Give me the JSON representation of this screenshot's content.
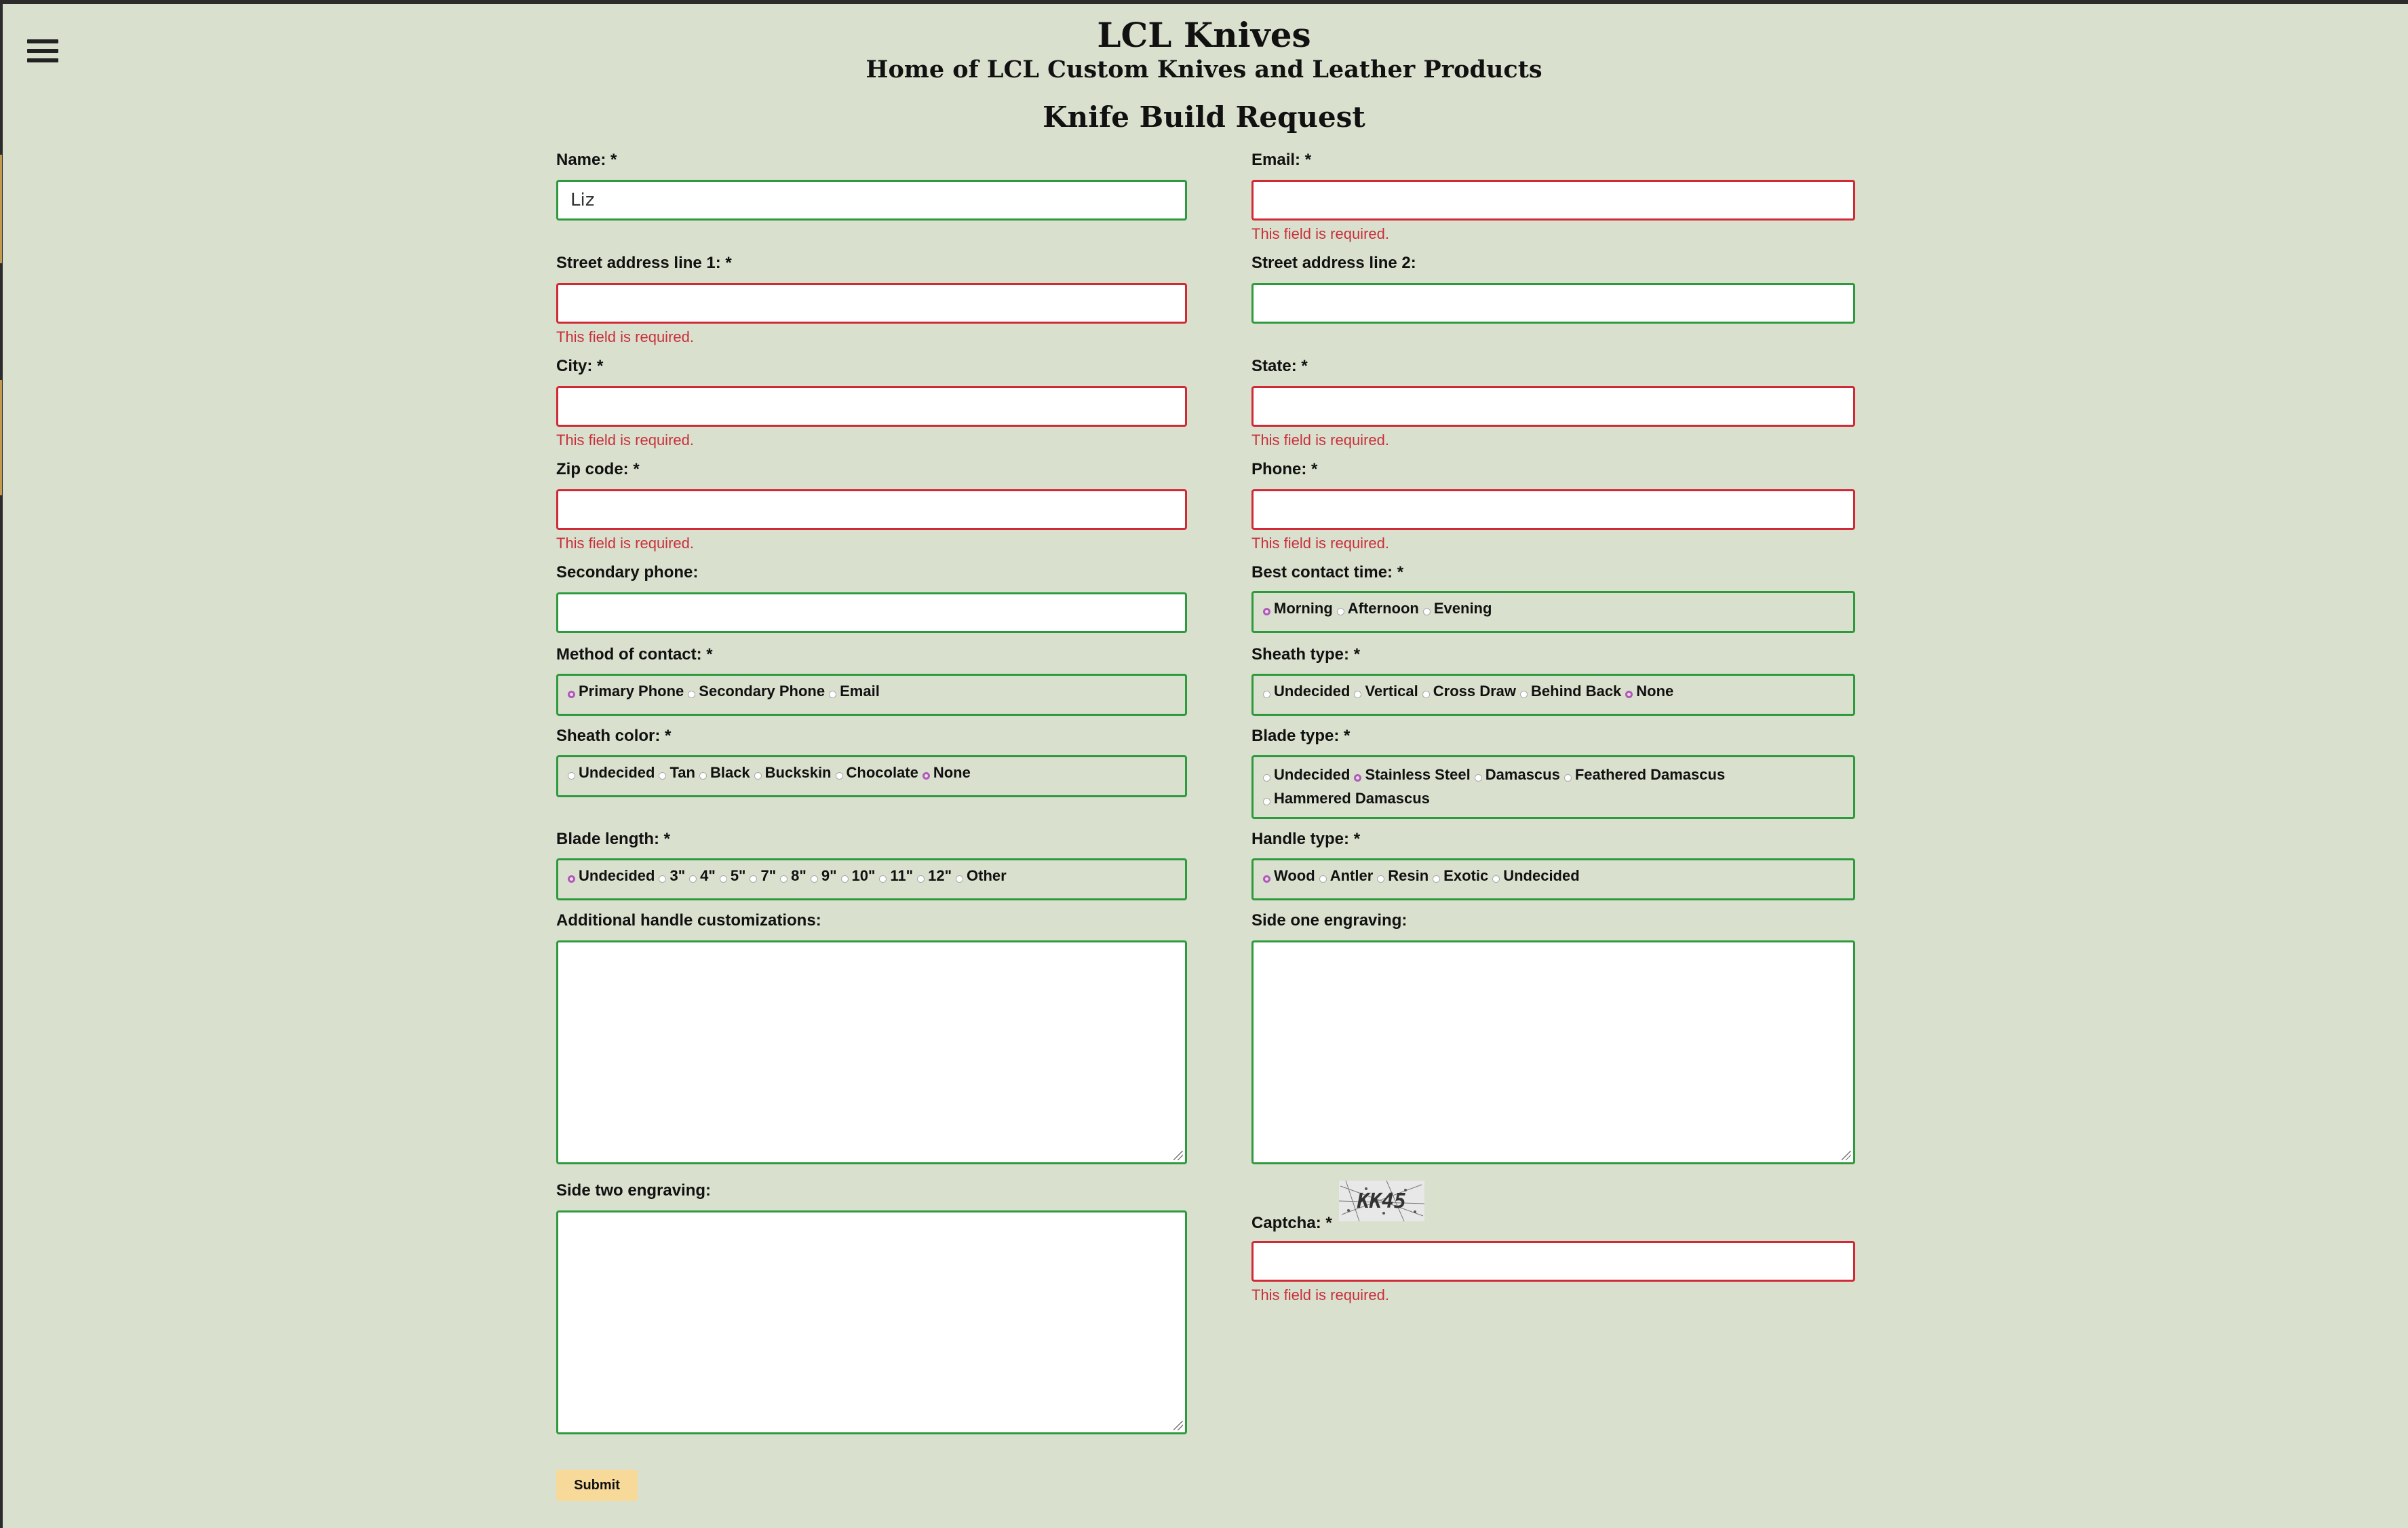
{
  "header": {
    "site_title": "LCL Knives",
    "tagline": "Home of LCL Custom Knives and Leather Products",
    "form_title": "Knife Build Request"
  },
  "nav": {
    "menu_icon": "hamburger-menu-icon"
  },
  "validation": {
    "required_message": "This field is required."
  },
  "fields": {
    "name": {
      "label": "Name: *",
      "value": "Liz"
    },
    "email": {
      "label": "Email: *",
      "value": ""
    },
    "street1": {
      "label": "Street address line 1: *",
      "value": ""
    },
    "street2": {
      "label": "Street address line 2:",
      "value": ""
    },
    "city": {
      "label": "City: *",
      "value": ""
    },
    "state": {
      "label": "State: *",
      "value": ""
    },
    "zip": {
      "label": "Zip code: *",
      "value": ""
    },
    "phone": {
      "label": "Phone: *",
      "value": ""
    },
    "secondary_phone": {
      "label": "Secondary phone:",
      "value": ""
    },
    "captcha": {
      "label": "Captcha: *",
      "value": "",
      "image_text": "KK45"
    }
  },
  "radios": {
    "best_contact_time": {
      "label": "Best contact time: *",
      "options": [
        "Morning",
        "Afternoon",
        "Evening"
      ],
      "selected": "Morning"
    },
    "method_of_contact": {
      "label": "Method of contact: *",
      "options": [
        "Primary Phone",
        "Secondary Phone",
        "Email"
      ],
      "selected": "Primary Phone"
    },
    "sheath_type": {
      "label": "Sheath type: *",
      "options": [
        "Undecided",
        "Vertical",
        "Cross Draw",
        "Behind Back",
        "None"
      ],
      "selected": "None"
    },
    "sheath_color": {
      "label": "Sheath color: *",
      "options": [
        "Undecided",
        "Tan",
        "Black",
        "Buckskin",
        "Chocolate",
        "None"
      ],
      "selected": "None"
    },
    "blade_type": {
      "label": "Blade type: *",
      "options": [
        "Undecided",
        "Stainless Steel",
        "Damascus",
        "Feathered Damascus",
        "Hammered Damascus"
      ],
      "selected": "Stainless Steel"
    },
    "blade_length": {
      "label": "Blade length: *",
      "options": [
        "Undecided",
        "3\"",
        "4\"",
        "5\"",
        "7\"",
        "8\"",
        "9\"",
        "10\"",
        "11\"",
        "12\"",
        "Other"
      ],
      "selected": "Undecided"
    },
    "handle_type": {
      "label": "Handle type: *",
      "options": [
        "Wood",
        "Antler",
        "Resin",
        "Exotic",
        "Undecided"
      ],
      "selected": "Wood"
    }
  },
  "textareas": {
    "handle_customizations": {
      "label": "Additional handle customizations:",
      "value": ""
    },
    "side_one_engraving": {
      "label": "Side one engraving:",
      "value": ""
    },
    "side_two_engraving": {
      "label": "Side two engraving:",
      "value": ""
    }
  },
  "submit_label": "Submit",
  "colors": {
    "background": "#dae0ce",
    "valid_border": "#2e9a3e",
    "error_border": "#d02a37",
    "error_text": "#c8303b",
    "submit_bg": "#f7d99a",
    "radio_selected": "#b05ab7"
  }
}
